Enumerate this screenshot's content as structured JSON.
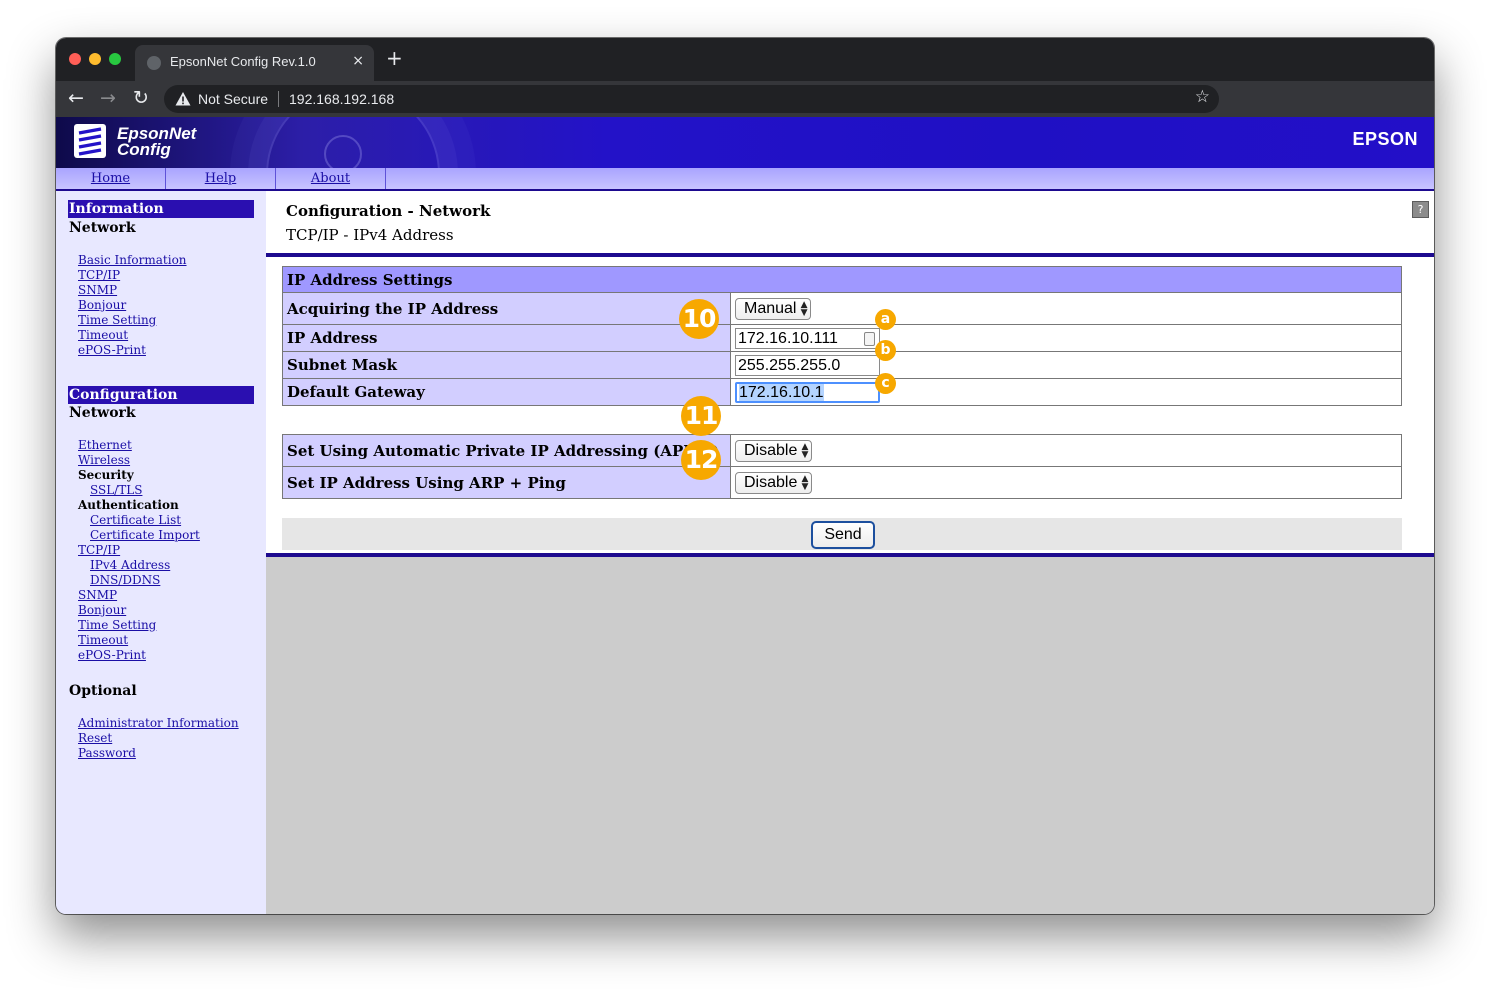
{
  "browser": {
    "tab_title": "EpsonNet Config Rev.1.0",
    "tab_close": "×",
    "new_tab": "+",
    "security_label": "Not Secure",
    "url": "192.168.192.168",
    "back": "←",
    "forward": "→",
    "reload": "↻",
    "bookmark": "☆"
  },
  "header": {
    "logo_line1": "EpsonNet",
    "logo_line2": "Config",
    "brand": "EPSON"
  },
  "menu": {
    "home": "Home",
    "help": "Help",
    "about": "About"
  },
  "sidebar": {
    "information_heading": "Information",
    "information_network": "Network",
    "information_links": [
      "Basic Information",
      "TCP/IP",
      "SNMP",
      "Bonjour",
      "Time Setting",
      "Timeout",
      "ePOS-Print"
    ],
    "configuration_heading": "Configuration",
    "configuration_network": "Network",
    "config_ethernet": "Ethernet",
    "config_wireless": "Wireless",
    "config_security": "Security",
    "config_ssl": "SSL/TLS",
    "config_authentication": "Authentication",
    "config_cert_list": "Certificate List",
    "config_cert_import": "Certificate Import",
    "config_tcpip": "TCP/IP",
    "config_ipv4": "IPv4 Address",
    "config_dns": "DNS/DDNS",
    "config_snmp": "SNMP",
    "config_bonjour": "Bonjour",
    "config_time": "Time Setting",
    "config_timeout": "Timeout",
    "config_epos": "ePOS-Print",
    "optional_heading": "Optional",
    "optional_links": [
      "Administrator Information",
      "Reset",
      "Password"
    ]
  },
  "main": {
    "title": "Configuration - Network",
    "subtitle": "TCP/IP - IPv4 Address",
    "help_icon": "?",
    "section_header": "IP Address Settings",
    "acquire_label": "Acquiring the IP Address",
    "acquire_value": "Manual",
    "ip_label": "IP Address",
    "ip_value": "172.16.10.111",
    "subnet_label": "Subnet Mask",
    "subnet_value": "255.255.255.0",
    "gateway_label": "Default Gateway",
    "gateway_value": "172.16.10.1",
    "apipa_label": "Set Using Automatic Private IP Addressing (APIPA)",
    "apipa_value": "Disable",
    "arp_label": "Set IP Address Using ARP + Ping",
    "arp_value": "Disable",
    "send_label": "Send"
  },
  "callouts": {
    "c10": "10",
    "c11": "11",
    "c12": "12",
    "ca": "a",
    "cb": "b",
    "cc": "c"
  },
  "colors": {
    "callout": "#f7a800",
    "banner": "#2312c8",
    "section_header": "#9f98ff",
    "label_bg": "#d2ceff",
    "sidebar_bg": "#e8e8ff"
  },
  "icons": {
    "select_arrow": "▲▼"
  }
}
